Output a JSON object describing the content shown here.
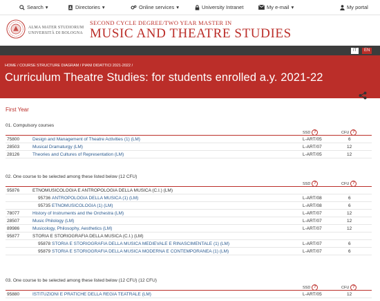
{
  "topbar": {
    "search": "Search",
    "directories": "Directories",
    "online_services": "Online services",
    "intranet": "University Intranet",
    "email": "My e-mail",
    "portal": "My portal"
  },
  "header": {
    "uni_line1": "ALMA MATER STUDIORUM",
    "uni_line2": "UNIVERSITÀ DI BOLOGNA",
    "program_type": "SECOND CYCLE DEGREE/TWO YEAR MASTER IN",
    "program_name": "MUSIC AND THEATRE STUDIES"
  },
  "lang": {
    "it": "IT",
    "en": "EN"
  },
  "banner": {
    "breadcrumb": "HOME / COURSE STRUCTURE DIAGRAM / PIANI DIDATTICI 2021-2022 /",
    "title": "Curriculum Theatre Studies: for students enrolled a.y. 2021-22"
  },
  "year": "First Year",
  "columns": {
    "ssd": "SSD",
    "cfu": "CFU",
    "help": "?"
  },
  "sections": [
    {
      "title": "01. Compulsory courses",
      "rows": [
        {
          "code": "75800",
          "name": "Design and Management of Theatre Activities (1) (LM)",
          "ssd": "L-ART/05",
          "cfu": "6"
        },
        {
          "code": "28503",
          "name": "Musical Dramaturgy (LM)",
          "ssd": "L-ART/07",
          "cfu": "12"
        },
        {
          "code": "28126",
          "name": "Theories and Cultures of Representation (LM)",
          "ssd": "L-ART/05",
          "cfu": "12"
        }
      ]
    },
    {
      "title": "02. One course to be selected among these listed below (12 CFU)",
      "rows": [
        {
          "code": "95876",
          "name": "ETNOMUSICOLOGIA E ANTROPOLOGIA DELLA MUSICA (C.I.) (LM)",
          "ssd": "",
          "cfu": ""
        },
        {
          "code": "95736",
          "name": "ANTROPOLOGIA DELLA MUSICA (1) (LM)",
          "ssd": "L-ART/08",
          "cfu": "6",
          "sub": true
        },
        {
          "code": "95735",
          "name": "ETNOMUSICOLOGIA (1) (LM)",
          "ssd": "L-ART/08",
          "cfu": "6",
          "sub": true
        },
        {
          "code": "78077",
          "name": "History of Instruments and the Orchestra (LM)",
          "ssd": "L-ART/07",
          "cfu": "12"
        },
        {
          "code": "28507",
          "name": "Music Philology (LM)",
          "ssd": "L-ART/07",
          "cfu": "12"
        },
        {
          "code": "89986",
          "name": "Musicology, Philosophy, Aesthetics (LM)",
          "ssd": "L-ART/07",
          "cfu": "12"
        },
        {
          "code": "95877",
          "name": "STORIA E STORIOGRAFIA DELLA MUSICA (C.I.) (LM)",
          "ssd": "",
          "cfu": ""
        },
        {
          "code": "95878",
          "name": "STORIA E STORIOGRAFIA DELLA MUSICA MEDIEVALE E RINASCIMENTALE (1) (LM)",
          "ssd": "L-ART/07",
          "cfu": "6",
          "sub": true
        },
        {
          "code": "95879",
          "name": "STORIA E STORIOGRAFIA DELLA MUSICA MODERNA E CONTEMPORANEA (1) (LM)",
          "ssd": "L-ART/07",
          "cfu": "6",
          "sub": true
        }
      ]
    },
    {
      "title": "03. One course to be selected among these listed below (12 CFU) (12 CFU)",
      "rows": [
        {
          "code": "95880",
          "name": "ISTITUZIONI E PRATICHE DELLA REGIA TEATRALE (LM)",
          "ssd": "L-ART/05",
          "cfu": "12"
        }
      ]
    }
  ],
  "colors": {
    "brand_red": "#bb2e29",
    "dark_bar": "#3c3c3c",
    "link_blue": "#2a5a8f"
  }
}
